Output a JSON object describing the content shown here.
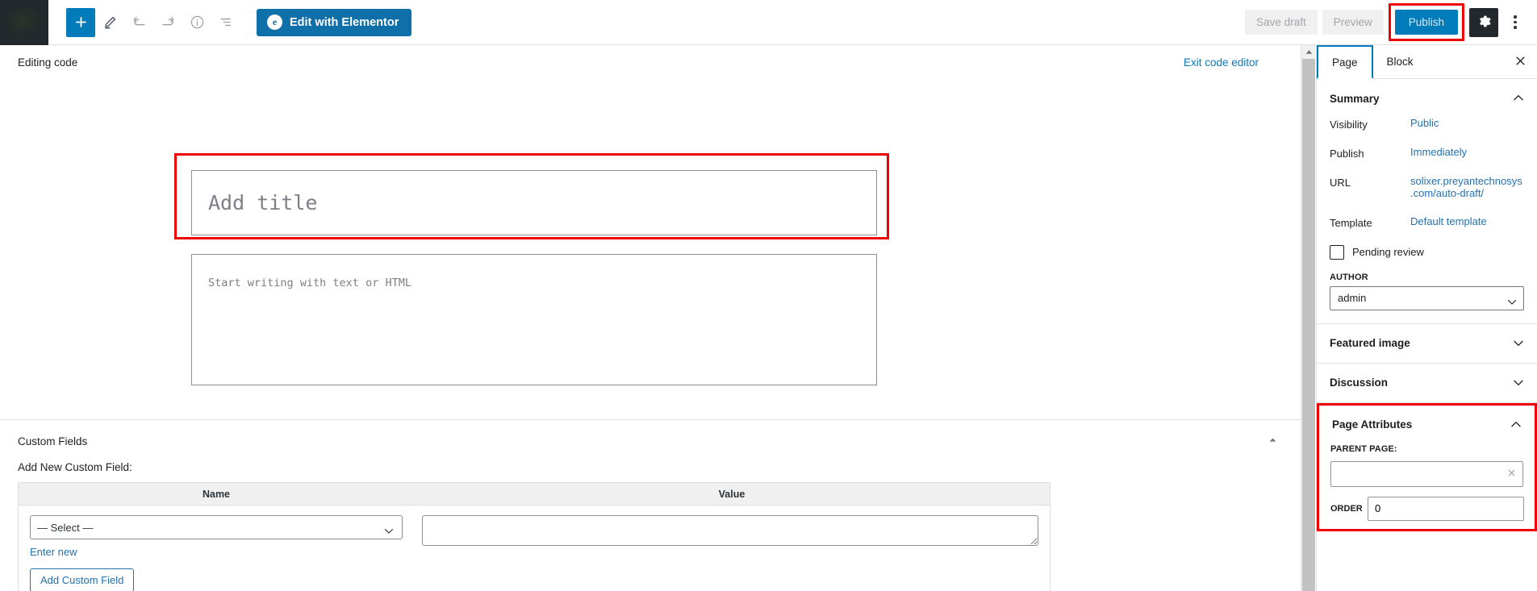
{
  "topbar": {
    "logo_icon": "wordpress-logo-icon",
    "tools": [
      {
        "name": "add-block-button",
        "icon": "plus-icon",
        "label": "Add block"
      },
      {
        "name": "edit-tool-button",
        "icon": "pencil-icon",
        "label": "Tools"
      },
      {
        "name": "undo-button",
        "icon": "undo-arrow-icon",
        "label": "Undo"
      },
      {
        "name": "redo-button",
        "icon": "redo-arrow-icon",
        "label": "Redo"
      },
      {
        "name": "details-button",
        "icon": "info-circle-icon",
        "label": "Details"
      },
      {
        "name": "list-view-button",
        "icon": "list-view-icon",
        "label": "List view"
      }
    ],
    "elementor_button": "Edit with Elementor",
    "elementor_badge": "e",
    "save_draft": "Save draft",
    "preview": "Preview",
    "publish": "Publish",
    "settings_icon": "gear-icon",
    "options_icon": "kebab-menu-icon"
  },
  "editor": {
    "editing_code_label": "Editing code",
    "exit_code_editor": "Exit code editor",
    "title_placeholder": "Add title",
    "title_value": "",
    "content_placeholder": "Start writing with text or HTML",
    "content_value": ""
  },
  "custom_fields": {
    "title": "Custom Fields",
    "collapse_icon": "chevron-up-icon",
    "subtitle": "Add New Custom Field:",
    "columns": [
      "Name",
      "Value"
    ],
    "name_select_value": "— Select —",
    "name_select_options": [
      "— Select —"
    ],
    "enter_new_link": "Enter new",
    "add_button": "Add Custom Field",
    "value_text": ""
  },
  "sidebar": {
    "tabs": [
      {
        "label": "Page",
        "active": true
      },
      {
        "label": "Block",
        "active": false
      }
    ],
    "close_icon": "close-icon",
    "summary": {
      "title": "Summary",
      "chevron": "chevron-up-icon",
      "rows": [
        {
          "label": "Visibility",
          "value": "Public"
        },
        {
          "label": "Publish",
          "value": "Immediately"
        },
        {
          "label": "URL",
          "value": "solixer.preyantechnosys.com/auto-draft/"
        },
        {
          "label": "Template",
          "value": "Default template"
        }
      ],
      "pending_review_label": "Pending review",
      "pending_review_checked": false,
      "author_label": "AUTHOR",
      "author_value": "admin",
      "author_options": [
        "admin"
      ]
    },
    "featured_image": {
      "title": "Featured image",
      "chevron": "chevron-down-icon"
    },
    "discussion": {
      "title": "Discussion",
      "chevron": "chevron-down-icon"
    },
    "page_attributes": {
      "title": "Page Attributes",
      "chevron": "chevron-up-icon",
      "parent_label": "PARENT PAGE:",
      "parent_value": "",
      "clear_icon": "close-x-icon",
      "order_label": "ORDER",
      "order_value": "0"
    }
  },
  "colors": {
    "accent_blue": "#007cba",
    "link_blue": "#2271b1",
    "highlight_red": "#ee0000",
    "dark": "#23282d"
  }
}
